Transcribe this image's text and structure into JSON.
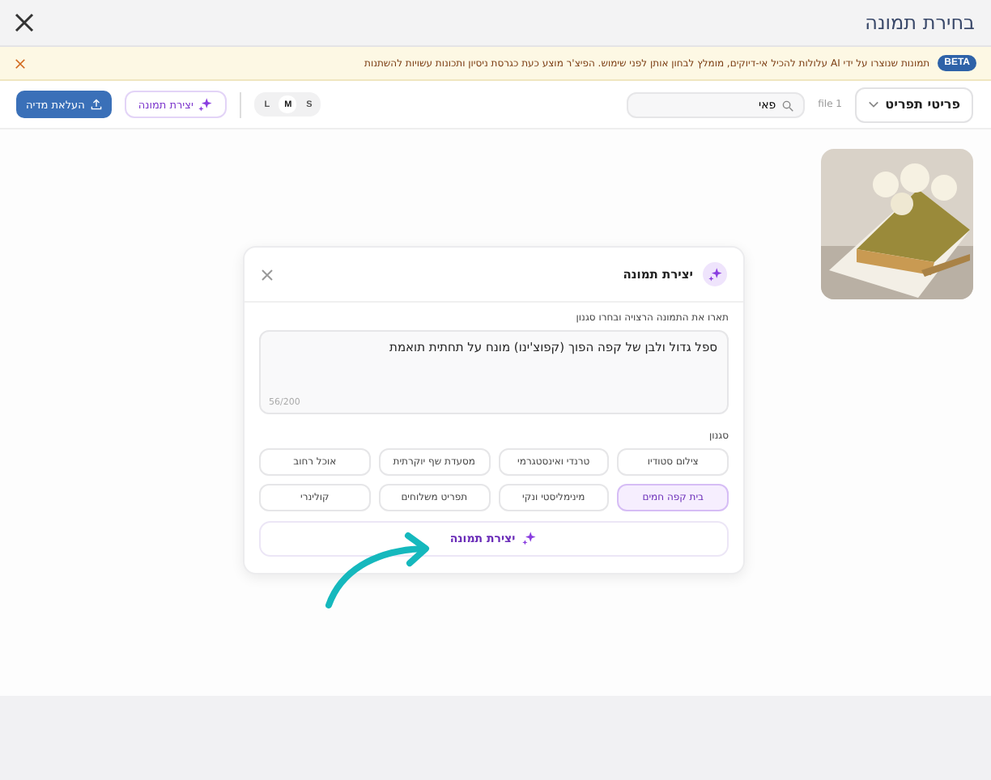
{
  "window": {
    "title": "בחירת תמונה"
  },
  "banner": {
    "badge": "BETA",
    "text": "תמונות שנוצרו על ידי AI עלולות להכיל אי-דיוקים, מומלץ לבחון אותן לפני שימוש. הפיצ'ר מוצע כעת כגרסת ניסיון ותכונות עשויות להשתנות"
  },
  "toolbar": {
    "category": "פריטי תפריט",
    "file_count": "file 1",
    "search": {
      "value": "פאי"
    },
    "sizes": [
      {
        "label": "S",
        "selected": false
      },
      {
        "label": "M",
        "selected": true
      },
      {
        "label": "L",
        "selected": false
      }
    ],
    "generate_button": "יצירת תמונה",
    "upload_button": "העלאת מדיה"
  },
  "modal": {
    "title": "יצירת תמונה",
    "prompt_label": "תארו את התמונה הרצויה ובחרו סגנון",
    "prompt": "ספל גדול ולבן של קפה הפוך (קפוצ'ינו) מונח על תחתית תואמת",
    "counter": "56/200",
    "style_label": "סגנון",
    "styles": [
      {
        "label": "צילום סטודיו",
        "selected": false
      },
      {
        "label": "טרנדי ואינסטגרמי",
        "selected": false
      },
      {
        "label": "מסעדת שף יוקרתית",
        "selected": false
      },
      {
        "label": "אוכל רחוב",
        "selected": false
      },
      {
        "label": "בית קפה חמים",
        "selected": true
      },
      {
        "label": "מינימליסטי ונקי",
        "selected": false
      },
      {
        "label": "תפריט משלוחים",
        "selected": false
      },
      {
        "label": "קולינרי",
        "selected": false
      }
    ],
    "submit": "יצירת תמונה"
  }
}
